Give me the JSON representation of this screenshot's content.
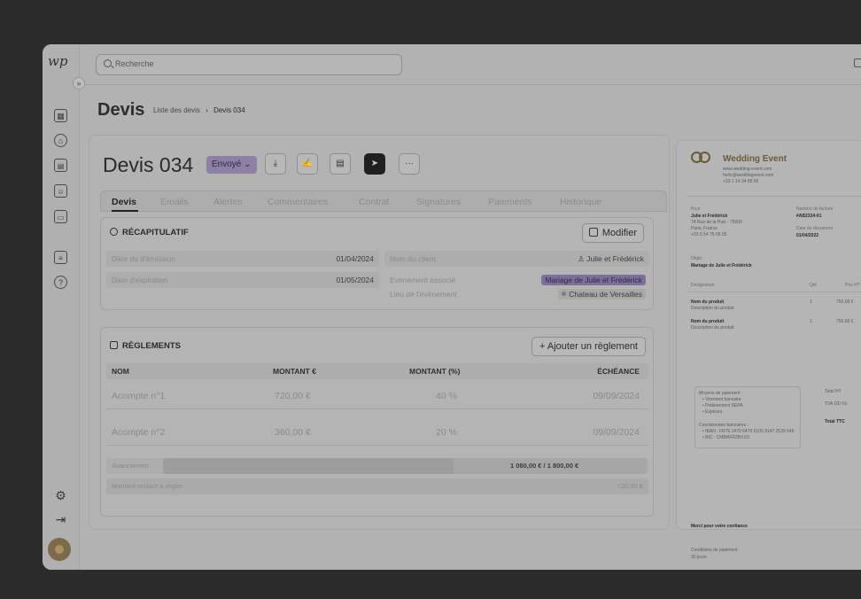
{
  "sidebar": {
    "logo_text": "wp",
    "collapse_glyph": "»",
    "icons": [
      "dashboard-icon",
      "home-icon",
      "calendar-icon",
      "contacts-icon",
      "presentation-icon",
      "document-icon",
      "help-icon",
      "settings-icon",
      "logout-icon"
    ]
  },
  "topbar": {
    "search_placeholder": "Recherche"
  },
  "header": {
    "title": "Devis",
    "breadcrumb": {
      "parent": "Liste des devis",
      "separator": "›",
      "current": "Devis 034"
    }
  },
  "document": {
    "title": "Devis 034",
    "status": "Envoyé ⌄",
    "toolbar": {
      "download": "⤓",
      "sign": "✍",
      "duplicate": "▤",
      "send": "➤",
      "more": "···"
    }
  },
  "tabs": [
    "Devis",
    "Emails",
    "Alertes",
    "Commentaires",
    "Contrat",
    "Signatures",
    "Paiements",
    "Historique"
  ],
  "recap": {
    "title": "RÉCAPITULATIF",
    "edit_label": "Modifier",
    "emission_label": "Date du d'émission",
    "emission_value": "01/04/2024",
    "expiration_label": "Date d'expiration",
    "expiration_value": "01/05/2024",
    "client_label": "Nom du client",
    "client_value": "♙ Julie et Frédérick",
    "event_label": "Evènement associé",
    "event_value": "Mariage de Julie et Frédérick",
    "place_label": "Lieu de l'évènement",
    "place_value": "Chateau de Versailles"
  },
  "payments": {
    "title": "RÈGLEMENTS",
    "add_label": "+ Ajouter un règlement",
    "columns": [
      "NOM",
      "MONTANT €",
      "MONTANT (%)",
      "ÉCHÉANCE"
    ],
    "rows": [
      {
        "name": "Acompte n°1",
        "amount": "720,00 €",
        "percent": "40 %",
        "due": "09/09/2024"
      },
      {
        "name": "Acompte n°2",
        "amount": "360,00 €",
        "percent": "20 %",
        "due": "09/09/2024"
      }
    ],
    "progress_label": "Avancement",
    "progress_text": "1 080,00 € / 1 800,00 €",
    "progress_fraction": 0.6,
    "remaining_label": "Montant restant à régler",
    "remaining_value": "720,00 €"
  },
  "preview": {
    "brand": "Wedding Event",
    "brand_lines": [
      "www.wedding-event.com",
      "hello@weddingevent.com",
      "+33 1 14 34 85 65"
    ],
    "for_label": "Pour",
    "client_name": "Julie et Frédérick",
    "client_address": [
      "74 Rue de la Paix - 75000",
      "Paris, France",
      "+33 6 54 75 65 05"
    ],
    "invoice_no_label": "Numéro de facture",
    "invoice_no": "#AB2324-01",
    "doc_date_label": "Date du document",
    "doc_date": "01/04/2022",
    "object_label": "Objet :",
    "object_value": "Mariage de Julie et Frédérick",
    "col_designation": "Désignation",
    "col_qty": "Qté",
    "col_price": "Prix HT",
    "items": [
      {
        "name": "Nom du produit",
        "desc": "Description du produit",
        "qty": "1",
        "price": "750,00 €"
      },
      {
        "name": "Nom du produit",
        "desc": "Description du produit",
        "qty": "1",
        "price": "750,00 €"
      }
    ],
    "payment_methods_title": "Moyens de paiement :",
    "payment_methods": [
      "• Virement bancaire",
      "• Prélèvement SEPA",
      "• Espèces"
    ],
    "bank_title": "Coordonnées bancaires :",
    "bank_lines": [
      "• IBAN : FR76 1470 6470 0105 9147 2535 546",
      "• BIC : CMBRFR2BXXX"
    ],
    "total_ht_label": "Total HT",
    "tva_label": "TVA (20 %)",
    "total_ttc_label": "Total TTC",
    "thanks": "Merci pour votre confiance",
    "conditions_label": "Conditions de paiement",
    "conditions_value": "30 jours"
  }
}
